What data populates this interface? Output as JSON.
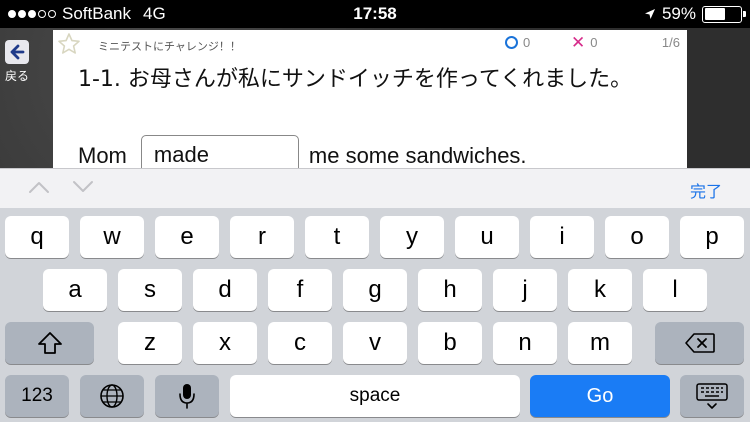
{
  "status_bar": {
    "carrier": "SoftBank",
    "network": "4G",
    "time": "17:58",
    "battery_percent": "59%",
    "battery_level": 0.59,
    "signal_bars_filled": 3,
    "signal_bars_total": 5
  },
  "nav": {
    "back_label": "戻る",
    "back_icon": "back-arrow-icon"
  },
  "card": {
    "header_title": "ミニテストにチャレンジ！！",
    "correct_count": "0",
    "wrong_count": "0",
    "progress": "1/6",
    "question": "1-1. お母さんが私にサンドイッチを作ってくれました。",
    "sentence_before": "Mom",
    "answer_value": "made",
    "sentence_after": "me some sandwiches."
  },
  "accessory": {
    "done_label": "完了"
  },
  "keyboard": {
    "row1": [
      "q",
      "w",
      "e",
      "r",
      "t",
      "y",
      "u",
      "i",
      "o",
      "p"
    ],
    "row2": [
      "a",
      "s",
      "d",
      "f",
      "g",
      "h",
      "j",
      "k",
      "l"
    ],
    "row3": [
      "z",
      "x",
      "c",
      "v",
      "b",
      "n",
      "m"
    ],
    "numbers_label": "123",
    "space_label": "space",
    "go_label": "Go"
  },
  "colors": {
    "accent": "#1a7cf5",
    "correct": "#1a73d9",
    "wrong": "#d62b8a"
  }
}
